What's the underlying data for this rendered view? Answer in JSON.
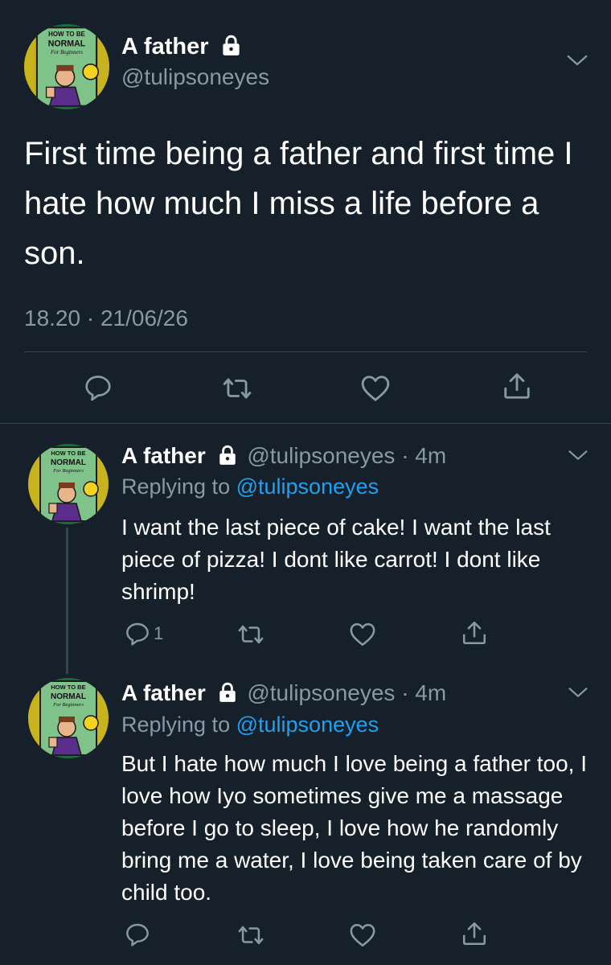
{
  "main_tweet": {
    "display_name": "A father",
    "handle": "@tulipsoneyes",
    "text": "First time being a father and first time I hate how much I miss a life before a son.",
    "timestamp": "18.20 · 21/06/26",
    "avatar_lines": [
      "HOW TO BE",
      "NORMAL",
      "For Beginners"
    ]
  },
  "replies": [
    {
      "display_name": "A father",
      "handle": "@tulipsoneyes",
      "age": "· 4m",
      "replying_prefix": "Replying to",
      "replying_to": "@tulipsoneyes",
      "text": "I want the last piece of cake! I want the last piece of pizza! I dont like carrot! I dont like shrimp!",
      "reply_count": "1"
    },
    {
      "display_name": "A father",
      "handle": "@tulipsoneyes",
      "age": "· 4m",
      "replying_prefix": "Replying to",
      "replying_to": "@tulipsoneyes",
      "text": "But I hate how much I love being a father too, I love how Iyo sometimes give me a massage before I go to sleep, I love how he randomly bring me a water, I love being taken care of by child too.",
      "reply_count": ""
    }
  ],
  "icons": {
    "lock": "lock-icon",
    "chevron": "chevron-down-icon",
    "reply": "reply-icon",
    "retweet": "retweet-icon",
    "like": "like-icon",
    "share": "share-icon"
  },
  "colors": {
    "background": "#15202b",
    "text": "#ffffff",
    "secondary": "#8899a6",
    "accent": "#1da1f2",
    "divider": "#38444d"
  }
}
